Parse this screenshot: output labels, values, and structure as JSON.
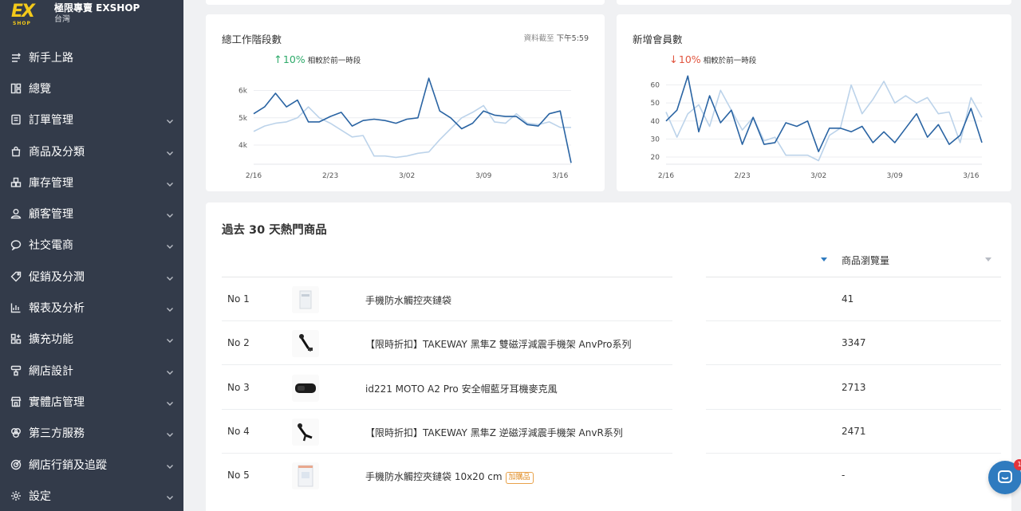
{
  "brand": {
    "logo_text": "EX",
    "logo_sub": "SHOP",
    "name": "極限專賣 EXSHOP",
    "region": "台灣"
  },
  "sidebar": {
    "items": [
      {
        "label": "新手上路",
        "icon": "beginner-icon",
        "expandable": false
      },
      {
        "label": "總覽",
        "icon": "overview-icon",
        "expandable": false
      },
      {
        "label": "訂單管理",
        "icon": "order-icon",
        "expandable": true
      },
      {
        "label": "商品及分類",
        "icon": "bag-icon",
        "expandable": true
      },
      {
        "label": "庫存管理",
        "icon": "inventory-icon",
        "expandable": true
      },
      {
        "label": "顧客管理",
        "icon": "customer-icon",
        "expandable": true
      },
      {
        "label": "社交電商",
        "icon": "chat-icon",
        "expandable": true
      },
      {
        "label": "促銷及分潤",
        "icon": "tag-icon",
        "expandable": true
      },
      {
        "label": "報表及分析",
        "icon": "report-icon",
        "expandable": true
      },
      {
        "label": "擴充功能",
        "icon": "apps-icon",
        "expandable": true
      },
      {
        "label": "網店設計",
        "icon": "brush-icon",
        "expandable": true
      },
      {
        "label": "實體店管理",
        "icon": "store-icon",
        "expandable": true
      },
      {
        "label": "第三方服務",
        "icon": "integration-icon",
        "expandable": true
      },
      {
        "label": "網店行銷及追蹤",
        "icon": "target-icon",
        "expandable": true
      },
      {
        "label": "設定",
        "icon": "gear-icon",
        "expandable": true
      }
    ]
  },
  "colors": {
    "sidebar_bg": "#333b4a",
    "line_current": "#2a64a3",
    "line_previous": "#bcd3ea",
    "up": "#2eaa6a",
    "down": "#e1553f",
    "logo": "#f3c91a"
  },
  "cards": {
    "stages": {
      "title": "總工作階段數",
      "meta_label": "資料截至",
      "meta_time": "下午5:59",
      "delta_arrow": "↑",
      "delta_pct": "10%",
      "delta_text": "相較於前一時段"
    },
    "members": {
      "title": "新增會員數",
      "delta_arrow": "↓",
      "delta_pct": "10%",
      "delta_text": "相較於前一時段"
    }
  },
  "chart_data": [
    {
      "type": "line",
      "title": "總工作階段數",
      "x_ticks": [
        "2/16",
        "2/23",
        "3/02",
        "3/09",
        "3/16"
      ],
      "y_ticks": [
        "4k",
        "5k",
        "6k"
      ],
      "ylim": [
        3300,
        6600
      ],
      "series": [
        {
          "values": [
            5150,
            5400,
            5900,
            5400,
            5650,
            4850,
            4850,
            5050,
            5200,
            4700,
            4900,
            4950,
            4900,
            4800,
            4950,
            5000,
            6450,
            5250,
            5000,
            4600,
            4800,
            5250,
            5100,
            5050,
            5050,
            4750,
            4700,
            5150,
            5250,
            3350
          ]
        },
        {
          "values": [
            4500,
            4700,
            4800,
            4850,
            5000,
            5400,
            5000,
            4800,
            4550,
            4300,
            4350,
            3600,
            3600,
            3550,
            3600,
            3700,
            3750,
            4200,
            4600,
            5000,
            5200,
            5450,
            4850,
            4800,
            5150,
            4800,
            4750,
            4850,
            4650,
            4650
          ]
        }
      ]
    },
    {
      "type": "line",
      "title": "新增會員數",
      "x_ticks": [
        "2/16",
        "2/23",
        "3/02",
        "3/09",
        "3/16"
      ],
      "y_ticks": [
        "20",
        "30",
        "40",
        "50",
        "60"
      ],
      "ylim": [
        16,
        66
      ],
      "series": [
        {
          "values": [
            40,
            46,
            65,
            34,
            54,
            39,
            46,
            27,
            42,
            27,
            28,
            39,
            37,
            40,
            23,
            36,
            36,
            34,
            37,
            28,
            34,
            28,
            36,
            44,
            31,
            38,
            27,
            32,
            47,
            28
          ]
        },
        {
          "values": [
            45,
            31,
            44,
            49,
            37,
            57,
            46,
            35,
            42,
            29,
            31,
            21,
            21,
            21,
            18,
            32,
            36,
            60,
            44,
            52,
            62,
            50,
            54,
            50,
            53,
            44,
            45,
            28,
            53,
            42
          ]
        }
      ]
    }
  ],
  "top_products": {
    "title": "過去 30 天熱門商品",
    "column_views": "商品瀏覽量",
    "rows": [
      {
        "rank": "No 1",
        "name": "手機防水觸控夾鏈袋",
        "badge": "",
        "views": "41",
        "thumb": "pouch"
      },
      {
        "rank": "No 2",
        "name": "【限時折扣】TAKEWAY 黑隼Z 雙磁浮減震手機架 AnvPro系列",
        "badge": "",
        "views": "3347",
        "thumb": "mount"
      },
      {
        "rank": "No 3",
        "name": "id221 MOTO A2 Pro 安全帽藍牙耳機麥克風",
        "badge": "",
        "views": "2713",
        "thumb": "headset"
      },
      {
        "rank": "No 4",
        "name": "【限時折扣】TAKEWAY 黑隼Z 逆磁浮減震手機架 AnvR系列",
        "badge": "",
        "views": "2471",
        "thumb": "mount2"
      },
      {
        "rank": "No 5",
        "name": "手機防水觸控夾鏈袋 10x20 cm",
        "badge": "加購品",
        "views": "-",
        "thumb": "pouch2"
      }
    ]
  },
  "chat": {
    "badge": "1"
  }
}
